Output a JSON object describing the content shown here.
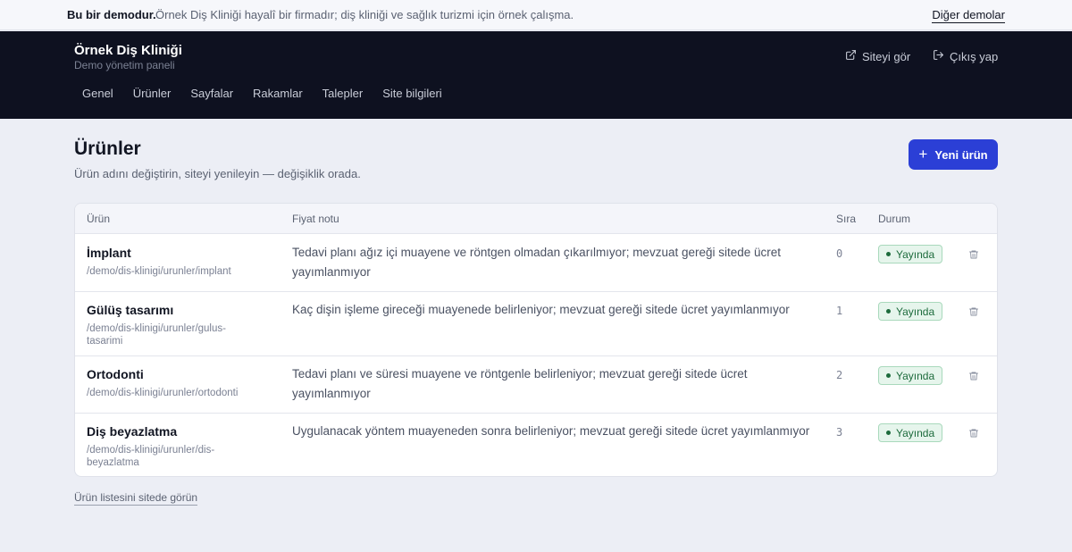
{
  "demo_bar": {
    "strong": "Bu bir demodur.",
    "message": "Örnek Diş Kliniği hayalî bir firmadır; diş kliniği ve sağlık turizmi için örnek çalışma.",
    "other_demos": "Diğer demolar"
  },
  "header": {
    "brand_title": "Örnek Diş Kliniği",
    "brand_subtitle": "Demo yönetim paneli",
    "view_site": "Siteyi gör",
    "logout": "Çıkış yap",
    "nav": [
      "Genel",
      "Ürünler",
      "Sayfalar",
      "Rakamlar",
      "Talepler",
      "Site bilgileri"
    ]
  },
  "page": {
    "title": "Ürünler",
    "subtitle": "Ürün adını değiştirin, siteyi yenileyin — değişiklik orada.",
    "new_button": "Yeni ürün"
  },
  "table": {
    "columns": {
      "product": "Ürün",
      "price_note": "Fiyat notu",
      "order": "Sıra",
      "status": "Durum"
    },
    "rows": [
      {
        "name": "İmplant",
        "path": "/demo/dis-klinigi/urunler/implant",
        "note": "Tedavi planı ağız içi muayene ve röntgen olmadan çıkarılmıyor; mevzuat gereği sitede ücret yayımlanmıyor",
        "order": "0",
        "status": "Yayında"
      },
      {
        "name": "Gülüş tasarımı",
        "path": "/demo/dis-klinigi/urunler/gulus-tasarimi",
        "note": "Kaç dişin işleme gireceği muayenede belirleniyor; mevzuat gereği sitede ücret yayımlanmıyor",
        "order": "1",
        "status": "Yayında"
      },
      {
        "name": "Ortodonti",
        "path": "/demo/dis-klinigi/urunler/ortodonti",
        "note": "Tedavi planı ve süresi muayene ve röntgenle belirleniyor; mevzuat gereği sitede ücret yayımlanmıyor",
        "order": "2",
        "status": "Yayında"
      },
      {
        "name": "Diş beyazlatma",
        "path": "/demo/dis-klinigi/urunler/dis-beyazlatma",
        "note": "Uygulanacak yöntem muayeneden sonra belirleniyor; mevzuat gereği sitede ücret yayımlanmıyor",
        "order": "3",
        "status": "Yayında"
      }
    ]
  },
  "footer": {
    "view_list": "Ürün listesini sitede görün"
  },
  "colors": {
    "accent": "#2b3fd6",
    "header_bg": "#0e1120",
    "status_green": "#1d6b3c"
  },
  "icons": {
    "view_site": "external-link-icon",
    "logout": "logout-icon",
    "add": "plus-icon",
    "delete": "trash-icon",
    "status": "dot-icon"
  }
}
